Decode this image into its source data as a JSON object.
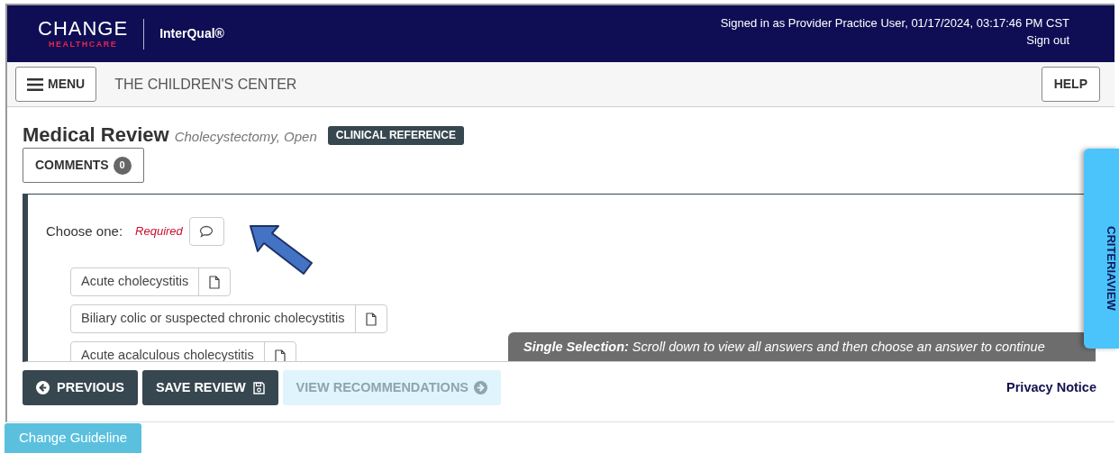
{
  "header": {
    "logo": {
      "word": "CHANGE",
      "sub": "HEALTHCARE"
    },
    "product": "InterQual®",
    "signed_in": "Signed in as Provider Practice User, 01/17/2024, 03:17:46 PM CST",
    "sign_out": "Sign out"
  },
  "toolbar": {
    "menu_button": "MENU",
    "organization": "THE CHILDREN'S CENTER",
    "help_button": "HELP"
  },
  "review": {
    "title": "Medical Review",
    "subtitle": "Cholecystectomy, Open",
    "badge": "CLINICAL REFERENCE",
    "comments_button": "COMMENTS",
    "comments_count": "0"
  },
  "question": {
    "prompt": "Choose one:",
    "required": "Required",
    "options": [
      {
        "label": "Acute cholecystitis"
      },
      {
        "label": "Biliary colic or suspected chronic cholecystitis"
      },
      {
        "label": "Acute acalculous cholecystitis"
      }
    ],
    "hint": "**Single Selection:** Scroll down to view all answers and then choose an answer to continue"
  },
  "side_tab": "CRITERIAVIEW",
  "actions": [
    {
      "kind": "previous",
      "label": "PREVIOUS",
      "disabled": false
    },
    {
      "kind": "save",
      "label": "SAVE REVIEW",
      "disabled": false
    },
    {
      "kind": "next",
      "label": "VIEW RECOMMENDATIONS",
      "disabled": true
    }
  ],
  "privacy_link": "Privacy Notice",
  "change_guideline_button": "Change Guideline"
}
